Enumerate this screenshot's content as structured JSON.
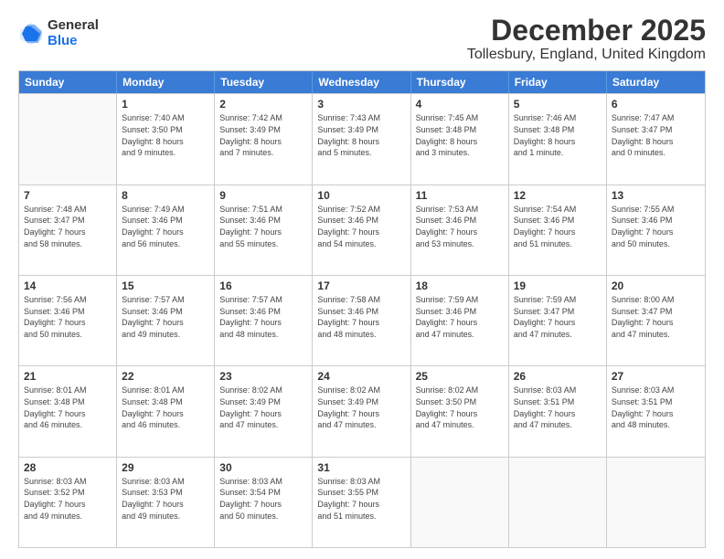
{
  "logo": {
    "general": "General",
    "blue": "Blue"
  },
  "title": "December 2025",
  "subtitle": "Tollesbury, England, United Kingdom",
  "headers": [
    "Sunday",
    "Monday",
    "Tuesday",
    "Wednesday",
    "Thursday",
    "Friday",
    "Saturday"
  ],
  "weeks": [
    [
      {
        "day": "",
        "info": ""
      },
      {
        "day": "1",
        "info": "Sunrise: 7:40 AM\nSunset: 3:50 PM\nDaylight: 8 hours\nand 9 minutes."
      },
      {
        "day": "2",
        "info": "Sunrise: 7:42 AM\nSunset: 3:49 PM\nDaylight: 8 hours\nand 7 minutes."
      },
      {
        "day": "3",
        "info": "Sunrise: 7:43 AM\nSunset: 3:49 PM\nDaylight: 8 hours\nand 5 minutes."
      },
      {
        "day": "4",
        "info": "Sunrise: 7:45 AM\nSunset: 3:48 PM\nDaylight: 8 hours\nand 3 minutes."
      },
      {
        "day": "5",
        "info": "Sunrise: 7:46 AM\nSunset: 3:48 PM\nDaylight: 8 hours\nand 1 minute."
      },
      {
        "day": "6",
        "info": "Sunrise: 7:47 AM\nSunset: 3:47 PM\nDaylight: 8 hours\nand 0 minutes."
      }
    ],
    [
      {
        "day": "7",
        "info": "Sunrise: 7:48 AM\nSunset: 3:47 PM\nDaylight: 7 hours\nand 58 minutes."
      },
      {
        "day": "8",
        "info": "Sunrise: 7:49 AM\nSunset: 3:46 PM\nDaylight: 7 hours\nand 56 minutes."
      },
      {
        "day": "9",
        "info": "Sunrise: 7:51 AM\nSunset: 3:46 PM\nDaylight: 7 hours\nand 55 minutes."
      },
      {
        "day": "10",
        "info": "Sunrise: 7:52 AM\nSunset: 3:46 PM\nDaylight: 7 hours\nand 54 minutes."
      },
      {
        "day": "11",
        "info": "Sunrise: 7:53 AM\nSunset: 3:46 PM\nDaylight: 7 hours\nand 53 minutes."
      },
      {
        "day": "12",
        "info": "Sunrise: 7:54 AM\nSunset: 3:46 PM\nDaylight: 7 hours\nand 51 minutes."
      },
      {
        "day": "13",
        "info": "Sunrise: 7:55 AM\nSunset: 3:46 PM\nDaylight: 7 hours\nand 50 minutes."
      }
    ],
    [
      {
        "day": "14",
        "info": "Sunrise: 7:56 AM\nSunset: 3:46 PM\nDaylight: 7 hours\nand 50 minutes."
      },
      {
        "day": "15",
        "info": "Sunrise: 7:57 AM\nSunset: 3:46 PM\nDaylight: 7 hours\nand 49 minutes."
      },
      {
        "day": "16",
        "info": "Sunrise: 7:57 AM\nSunset: 3:46 PM\nDaylight: 7 hours\nand 48 minutes."
      },
      {
        "day": "17",
        "info": "Sunrise: 7:58 AM\nSunset: 3:46 PM\nDaylight: 7 hours\nand 48 minutes."
      },
      {
        "day": "18",
        "info": "Sunrise: 7:59 AM\nSunset: 3:46 PM\nDaylight: 7 hours\nand 47 minutes."
      },
      {
        "day": "19",
        "info": "Sunrise: 7:59 AM\nSunset: 3:47 PM\nDaylight: 7 hours\nand 47 minutes."
      },
      {
        "day": "20",
        "info": "Sunrise: 8:00 AM\nSunset: 3:47 PM\nDaylight: 7 hours\nand 47 minutes."
      }
    ],
    [
      {
        "day": "21",
        "info": "Sunrise: 8:01 AM\nSunset: 3:48 PM\nDaylight: 7 hours\nand 46 minutes."
      },
      {
        "day": "22",
        "info": "Sunrise: 8:01 AM\nSunset: 3:48 PM\nDaylight: 7 hours\nand 46 minutes."
      },
      {
        "day": "23",
        "info": "Sunrise: 8:02 AM\nSunset: 3:49 PM\nDaylight: 7 hours\nand 47 minutes."
      },
      {
        "day": "24",
        "info": "Sunrise: 8:02 AM\nSunset: 3:49 PM\nDaylight: 7 hours\nand 47 minutes."
      },
      {
        "day": "25",
        "info": "Sunrise: 8:02 AM\nSunset: 3:50 PM\nDaylight: 7 hours\nand 47 minutes."
      },
      {
        "day": "26",
        "info": "Sunrise: 8:03 AM\nSunset: 3:51 PM\nDaylight: 7 hours\nand 47 minutes."
      },
      {
        "day": "27",
        "info": "Sunrise: 8:03 AM\nSunset: 3:51 PM\nDaylight: 7 hours\nand 48 minutes."
      }
    ],
    [
      {
        "day": "28",
        "info": "Sunrise: 8:03 AM\nSunset: 3:52 PM\nDaylight: 7 hours\nand 49 minutes."
      },
      {
        "day": "29",
        "info": "Sunrise: 8:03 AM\nSunset: 3:53 PM\nDaylight: 7 hours\nand 49 minutes."
      },
      {
        "day": "30",
        "info": "Sunrise: 8:03 AM\nSunset: 3:54 PM\nDaylight: 7 hours\nand 50 minutes."
      },
      {
        "day": "31",
        "info": "Sunrise: 8:03 AM\nSunset: 3:55 PM\nDaylight: 7 hours\nand 51 minutes."
      },
      {
        "day": "",
        "info": ""
      },
      {
        "day": "",
        "info": ""
      },
      {
        "day": "",
        "info": ""
      }
    ]
  ]
}
